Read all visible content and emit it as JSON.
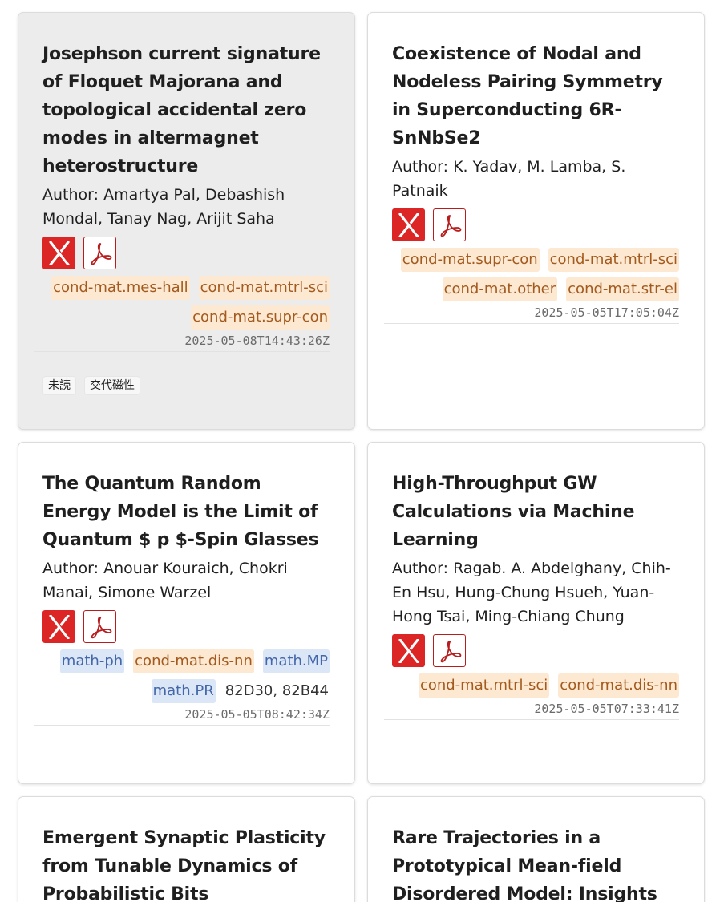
{
  "papers": [
    {
      "title": "Josephson current signature of Floquet Majorana and topological accidental zero modes in altermagnet heterostructure",
      "author": "Author: Amartya Pal, Debashish Mondal, Tanay Nag, Arijit Saha",
      "tags": [
        "cond-mat.mes-hall",
        "cond-mat.mtrl-sci",
        "cond-mat.supr-con"
      ],
      "date": "2025-05-08T14:43:26Z",
      "labels": [
        "未読",
        "交代磁性"
      ]
    },
    {
      "title": "Coexistence of Nodal and Nodeless Pairing Symmetry in Superconducting 6R-SnNbSe2",
      "author": "Author: K. Yadav, M. Lamba, S. Patnaik",
      "tags": [
        "cond-mat.supr-con",
        "cond-mat.mtrl-sci",
        "cond-mat.other",
        "cond-mat.str-el"
      ],
      "date": "2025-05-05T17:05:04Z"
    },
    {
      "title": "The Quantum Random Energy Model is the Limit of Quantum $ p $-Spin Glasses",
      "author": "Author: Anouar Kouraich, Chokri Manai, Simone Warzel",
      "tags": [
        "math-ph",
        "cond-mat.dis-nn",
        "math.MP",
        "math.PR",
        "82D30, 82B44"
      ],
      "date": "2025-05-05T08:42:34Z"
    },
    {
      "title": "High-Throughput GW Calculations via Machine Learning",
      "author": "Author: Ragab. A. Abdelghany, Chih-En Hsu, Hung-Chung Hsueh, Yuan-Hong Tsai, Ming-Chiang Chung",
      "tags": [
        "cond-mat.mtrl-sci",
        "cond-mat.dis-nn"
      ],
      "date": "2025-05-05T07:33:41Z"
    },
    {
      "title": "Emergent Synaptic Plasticity from Tunable Dynamics of Probabilistic Bits"
    },
    {
      "title": "Rare Trajectories in a Prototypical Mean-field Disordered Model: Insights into"
    }
  ],
  "icons": {
    "x_link": "x-logo-icon",
    "pdf_link": "pdf-icon"
  },
  "colors": {
    "x_red": "#dc2626",
    "tag_orange_bg": "#fde8d2",
    "tag_blue_bg": "#dbe6f7",
    "read_card_bg": "#ececec"
  }
}
